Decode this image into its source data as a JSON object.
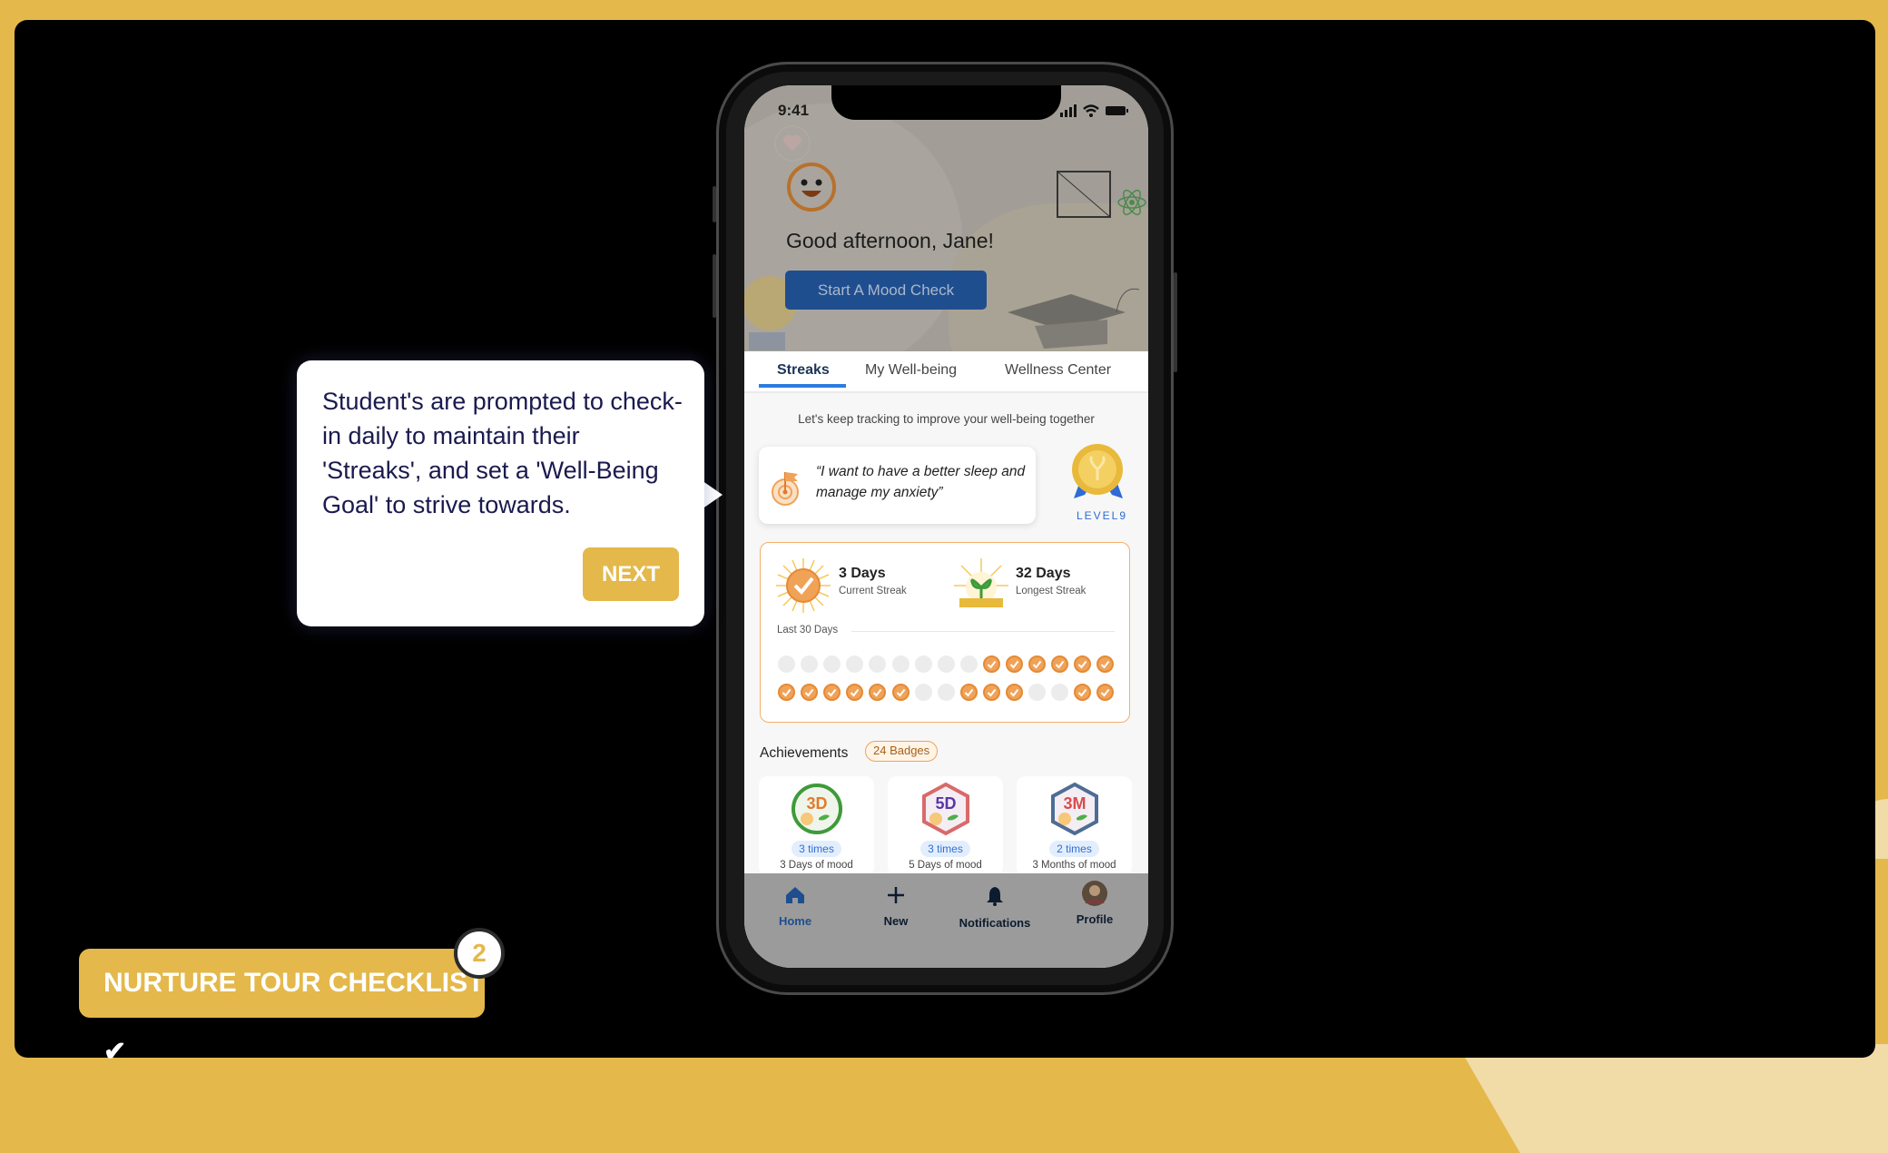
{
  "colors": {
    "brand_gold": "#e4b84a",
    "primary_blue": "#1f4e8f",
    "streak_orange": "#f0a257",
    "tab_active": "#2d7be0"
  },
  "status_bar": {
    "time": "9:41",
    "icons": [
      "signal-icon",
      "wifi-icon",
      "battery-icon"
    ]
  },
  "header": {
    "greeting": "Good afternoon, Jane!",
    "mood_check_button": "Start A Mood Check"
  },
  "tabs": [
    {
      "label": "Streaks",
      "active": true
    },
    {
      "label": "My Well-being",
      "active": false
    },
    {
      "label": "Wellness Center",
      "active": false
    }
  ],
  "streaks": {
    "subtitle": "Let's keep tracking to improve your well-being together",
    "goal": "“I want to have a better sleep and manage my anxiety”",
    "level": "LEVEL9",
    "current": {
      "value": "3 Days",
      "label": "Current Streak"
    },
    "longest": {
      "value": "32 Days",
      "label": "Longest Streak"
    },
    "last_30_label": "Last 30 Days",
    "last_30_days": [
      0,
      0,
      0,
      0,
      0,
      0,
      0,
      0,
      0,
      1,
      1,
      1,
      1,
      1,
      1,
      1,
      1,
      1,
      1,
      1,
      1,
      0,
      0,
      1,
      1,
      1,
      0,
      0,
      1,
      1
    ]
  },
  "achievements": {
    "title": "Achievements",
    "badge_count": "24 Badges",
    "items": [
      {
        "badge": "3D",
        "times": "3 times",
        "label": "3 Days of mood"
      },
      {
        "badge": "5D",
        "times": "3 times",
        "label": "5 Days of mood"
      },
      {
        "badge": "3M",
        "times": "2 times",
        "label": "3 Months of mood"
      }
    ]
  },
  "nav": [
    {
      "label": "Home",
      "icon": "home-icon",
      "active": true
    },
    {
      "label": "New",
      "icon": "plus-icon"
    },
    {
      "label": "Notifications",
      "icon": "bell-icon"
    },
    {
      "label": "Profile",
      "icon": "avatar"
    }
  ],
  "tour": {
    "text": "Student's are prompted to check-in daily to maintain their 'Streaks', and set a 'Well-Being Goal' to strive towards.",
    "next_label": "NEXT",
    "checklist_label": "NURTURE TOUR CHECKLIST ✔",
    "checklist_count": "2"
  }
}
